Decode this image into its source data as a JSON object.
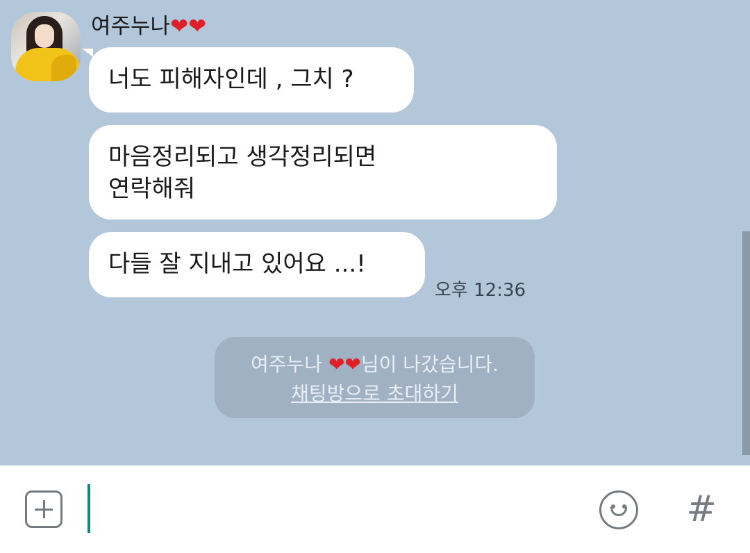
{
  "chat": {
    "sender": {
      "name": "여주누나",
      "name_hearts": "❤❤",
      "avatar": "profile-photo"
    },
    "messages": [
      {
        "text": "너도 피해자인데 , 그치 ?"
      },
      {
        "text": "마음정리되고 생각정리되면\n연락해줘"
      },
      {
        "text": "다들 잘 지내고 있어요 ...!"
      }
    ],
    "last_time": "오후 12:36",
    "notice": {
      "name": "여주누나",
      "hearts": "❤❤",
      "left_text": "님이 나갔습니다.",
      "invite_link": "채팅방으로 초대하기"
    }
  },
  "input_bar": {
    "plus_icon": "plus-square-icon",
    "text_value": "",
    "emoji_icon": "smiley-icon",
    "hash_label": "#",
    "caret_color": "#0f8a78"
  },
  "colors": {
    "chat_background": "#b2c7da",
    "bubble": "#ffffff",
    "notice_background": "#9fb1c2",
    "heart": "#e02028"
  }
}
